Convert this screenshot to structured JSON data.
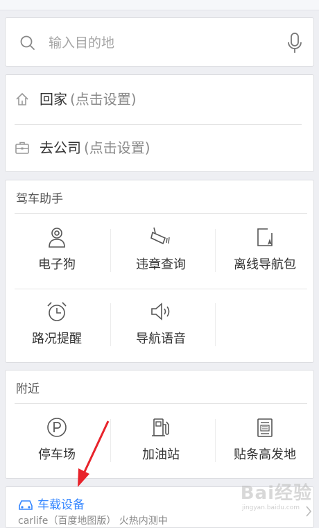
{
  "search": {
    "placeholder": "输入目的地"
  },
  "places": [
    {
      "name": "回家",
      "hint": "(点击设置)"
    },
    {
      "name": "去公司",
      "hint": "(点击设置)"
    }
  ],
  "driving_assistant": {
    "title": "驾车助手",
    "items": [
      {
        "label": "电子狗",
        "icon": "camera-dog-icon"
      },
      {
        "label": "违章查询",
        "icon": "traffic-camera-icon"
      },
      {
        "label": "离线导航包",
        "icon": "offline-map-icon"
      },
      {
        "label": "路况提醒",
        "icon": "alarm-clock-icon"
      },
      {
        "label": "导航语音",
        "icon": "speaker-icon"
      }
    ]
  },
  "nearby": {
    "title": "附近",
    "items": [
      {
        "label": "停车场",
        "icon": "parking-icon"
      },
      {
        "label": "加油站",
        "icon": "gas-station-icon"
      },
      {
        "label": "贴条高发地",
        "icon": "ticket-icon"
      }
    ]
  },
  "car_device": {
    "title": "车载设备",
    "subtitle": "carlife（百度地图版） 火热内测中"
  },
  "watermark": {
    "brand": "Bai经验",
    "url": "jingyan.baidu.com"
  },
  "colors": {
    "accent": "#3385ff",
    "annotation": "#e8232b"
  }
}
